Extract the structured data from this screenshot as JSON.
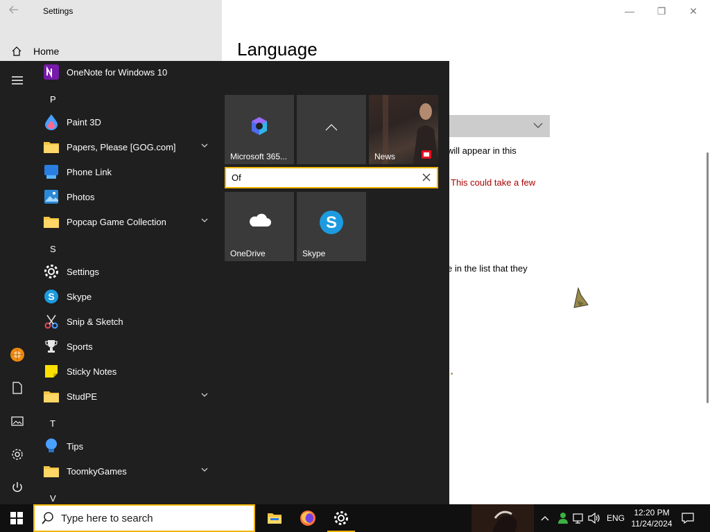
{
  "window": {
    "title": "Settings",
    "back_icon": "back-arrow-icon",
    "minimize": "—",
    "maximize": "❐",
    "close": "✕"
  },
  "sidebar": {
    "home_label": "Home"
  },
  "main": {
    "title": "Language",
    "line1": "will appear in this",
    "line2": "This could take a few",
    "line3": "e in the list that they"
  },
  "start_menu": {
    "letters": {
      "p": "P",
      "s": "S",
      "t": "T",
      "v": "V"
    },
    "apps": {
      "onenote": "OneNote for Windows 10",
      "paint3d": "Paint 3D",
      "papers_please": "Papers, Please [GOG.com]",
      "phone_link": "Phone Link",
      "photos": "Photos",
      "popcap": "Popcap Game Collection",
      "settings": "Settings",
      "skype": "Skype",
      "snip": "Snip & Sketch",
      "sports": "Sports",
      "sticky": "Sticky Notes",
      "studpe": "StudPE",
      "tips": "Tips",
      "toomky": "ToomkyGames"
    },
    "tiles": {
      "m365": "Microsoft 365...",
      "news": "News",
      "onedrive": "OneDrive",
      "skype": "Skype"
    },
    "folder_name_value": "Of"
  },
  "taskbar": {
    "search_placeholder": "Type here to search",
    "lang": "ENG",
    "time": "12:20 PM",
    "date": "11/24/2024"
  },
  "colors": {
    "start_bg": "#1f1f1f",
    "tile_bg": "#3a3a3a",
    "accent": "#f0b400",
    "taskbar_bg": "#101010",
    "sidebar_bg": "#e6e6e6"
  }
}
